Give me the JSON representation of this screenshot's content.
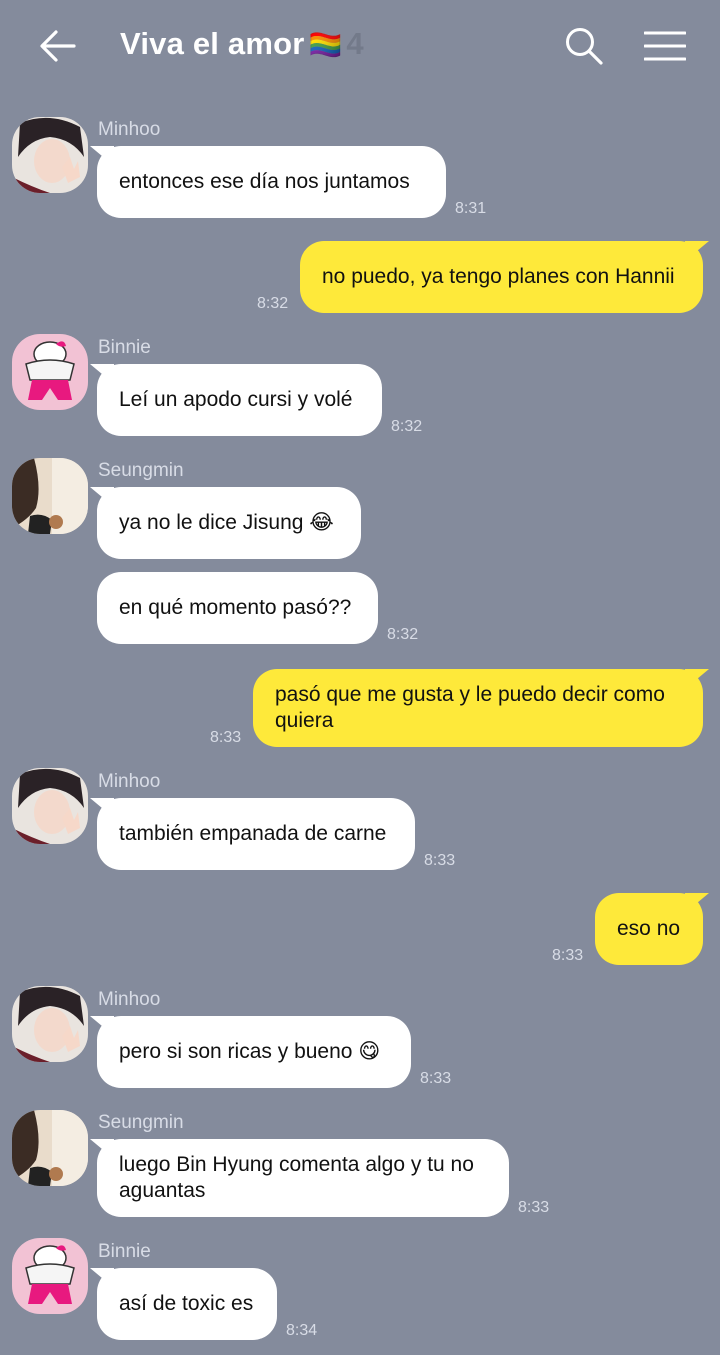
{
  "header": {
    "title": "Viva el amor",
    "flag": "🏳️‍🌈",
    "member_count": "4",
    "back_icon": "back-arrow-icon",
    "search_icon": "search-icon",
    "menu_icon": "hamburger-menu-icon"
  },
  "colors": {
    "background": "#848b9c",
    "incoming_bubble": "#ffffff",
    "outgoing_bubble": "#fee93a"
  },
  "messages": [
    {
      "sender": "Minhoo",
      "text": "entonces ese día nos juntamos",
      "time": "8:31"
    },
    {
      "text": "no puedo, ya tengo planes con Hannii",
      "time": "8:32"
    },
    {
      "sender": "Binnie",
      "text": "Leí un apodo cursi y volé",
      "time": "8:32"
    },
    {
      "sender": "Seungmin",
      "text": "ya no le dice Jisung",
      "emoji": "😂"
    },
    {
      "text": "en qué momento pasó??",
      "time": "8:32"
    },
    {
      "line1": "pasó que me gusta y le puedo decir como",
      "line2": "quiera",
      "time": "8:33"
    },
    {
      "sender": "Minhoo",
      "text": "también empanada de carne",
      "time": "8:33"
    },
    {
      "text": "eso no",
      "time": "8:33"
    },
    {
      "sender": "Minhoo",
      "text": "pero si son ricas y bueno",
      "emoji": "😋",
      "time": "8:33"
    },
    {
      "sender": "Seungmin",
      "line1": "luego Bin Hyung comenta algo y tu no",
      "line2": "aguantas",
      "time": "8:33"
    },
    {
      "sender": "Binnie",
      "text": "así de toxic es",
      "time": "8:34"
    }
  ]
}
